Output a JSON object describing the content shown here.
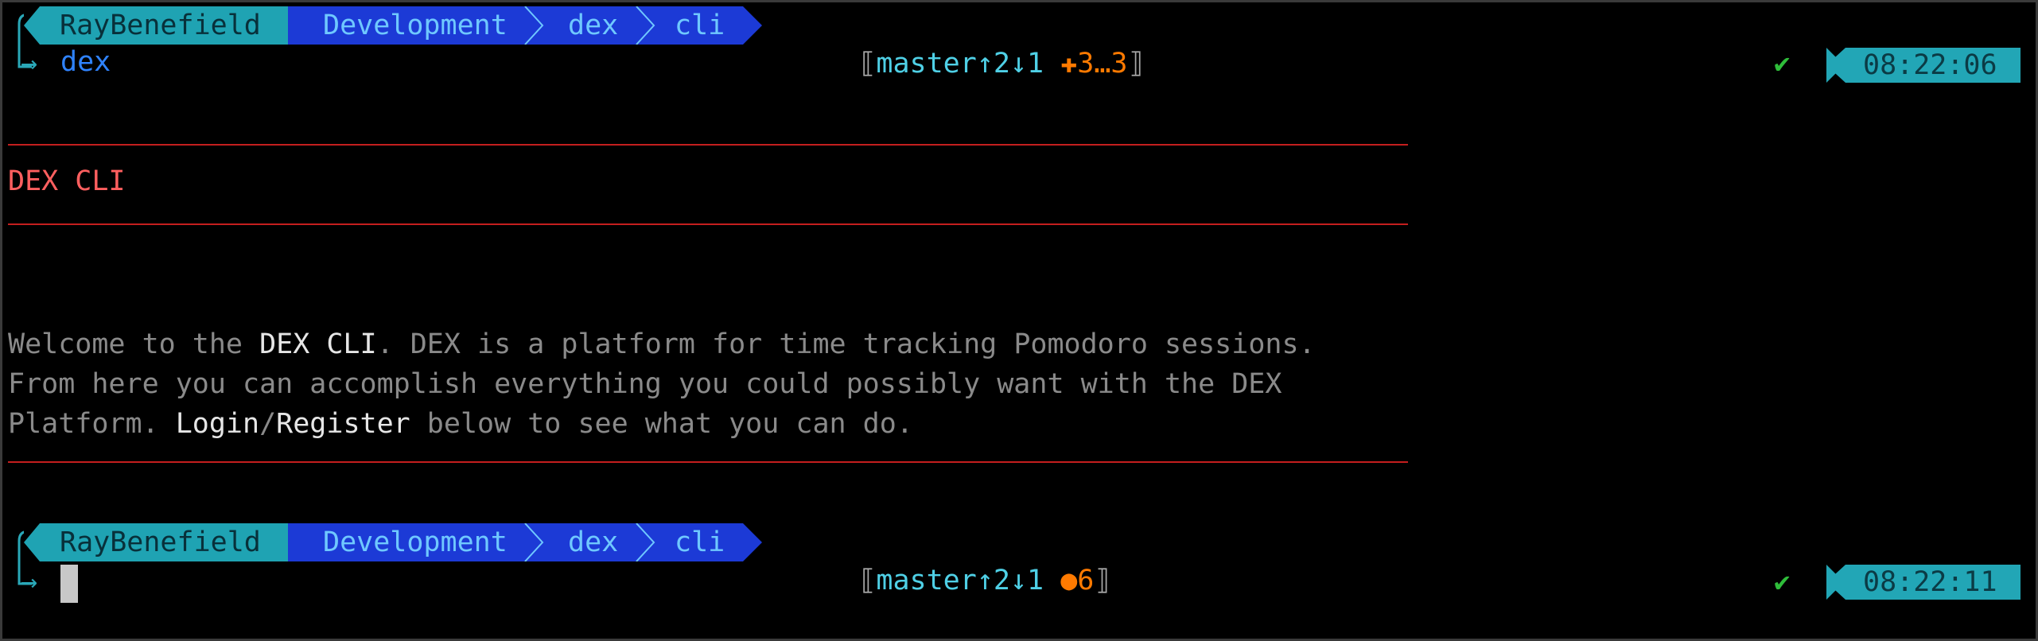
{
  "prompt1": {
    "user": "RayBenefield",
    "path": [
      "Development",
      "dex",
      "cli"
    ],
    "git": {
      "open": "⟦",
      "branch": "master",
      "ahead_behind": "↑2↓1",
      "status": "✚3…3",
      "close": "⟧"
    },
    "command": "dex",
    "check": "✔",
    "time": "08:22:06"
  },
  "output": {
    "heading": "DEX CLI",
    "line1_a": "Welcome to the ",
    "line1_b": "DEX CLI",
    "line1_c": ". DEX is a platform for time tracking Pomodoro sessions.",
    "line2": "From here you can accomplish everything you could possibly want with the DEX",
    "line3_a": "Platform. ",
    "line3_b": "Login",
    "line3_c": "/",
    "line3_d": "Register",
    "line3_e": " below to see what you can do."
  },
  "prompt2": {
    "user": "RayBenefield",
    "path": [
      "Development",
      "dex",
      "cli"
    ],
    "git": {
      "open": "⟦",
      "branch": "master",
      "ahead_behind": "↑2↓1",
      "status": "●6",
      "close": "⟧"
    },
    "check": "✔",
    "time": "08:22:11"
  },
  "colors": {
    "background": "#000000",
    "user_segment": "#1fa3b3",
    "path_segment": "#1c3ad6",
    "separator_rule": "#c41e1e",
    "heading": "#ff5f5f",
    "git_status": "#ff7a00",
    "check": "#2fbd3a"
  }
}
